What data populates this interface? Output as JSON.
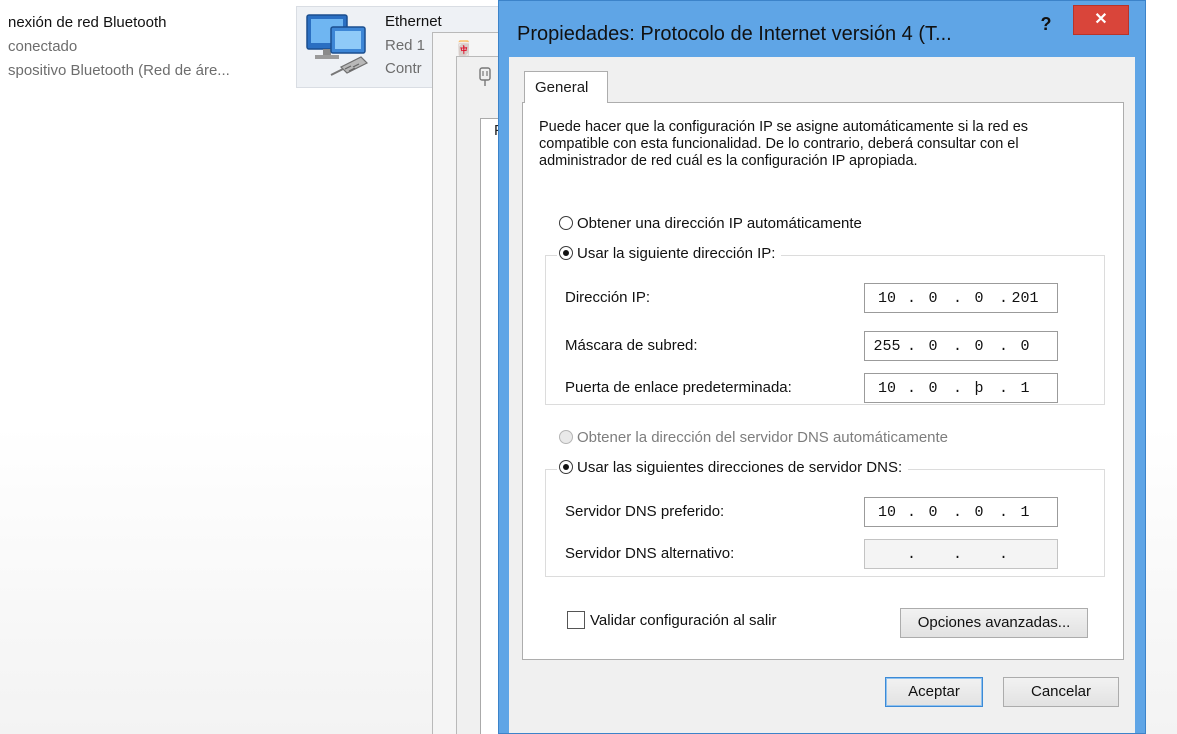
{
  "connections": {
    "bluetooth": {
      "title": "nexión de red Bluetooth",
      "status": "conectado",
      "device": "spositivo Bluetooth (Red de áre..."
    },
    "ethernet": {
      "title": "Ethernet",
      "network": "Red 1",
      "controller": "Contr"
    }
  },
  "background": {
    "partial_tab_label": "F"
  },
  "dialog": {
    "title": "Propiedades: Protocolo de Internet versión 4 (T...",
    "help_label": "?",
    "close_label": "✕",
    "tab_general": "General",
    "description": "Puede hacer que la configuración IP se asigne automáticamente si la red es compatible con esta funcionalidad. De lo contrario, deberá consultar con el administrador de red cuál es la configuración IP apropiada.",
    "ip_auto_label": "Obtener una dirección IP automáticamente",
    "ip_manual_label": "Usar la siguiente dirección IP:",
    "ip_manual_selected": true,
    "ip_fields": {
      "ip_address": {
        "label": "Dirección IP:",
        "octets": [
          "10",
          "0",
          "0",
          "201"
        ]
      },
      "subnet_mask": {
        "label": "Máscara de subred:",
        "octets": [
          "255",
          "0",
          "0",
          "0"
        ]
      },
      "gateway": {
        "label": "Puerta de enlace predeterminada:",
        "octets": [
          "10",
          "0",
          "þ",
          "1"
        ]
      }
    },
    "dns_auto_label": "Obtener la dirección del servidor DNS automáticamente",
    "dns_manual_label": "Usar las siguientes direcciones de servidor DNS:",
    "dns_manual_selected": true,
    "dns_fields": {
      "preferred": {
        "label": "Servidor DNS preferido:",
        "octets": [
          "10",
          "0",
          "0",
          "1"
        ]
      },
      "alternate": {
        "label": "Servidor DNS alternativo:",
        "octets": [
          "",
          "",
          "",
          ""
        ]
      }
    },
    "validate_label": "Validar configuración al salir",
    "validate_checked": false,
    "advanced_button": "Opciones avanzadas...",
    "ok_button": "Aceptar",
    "cancel_button": "Cancelar"
  },
  "colors": {
    "dialog_frame": "#5fa5e6",
    "close_button": "#d9453a",
    "client_bg": "#f0f0f0"
  }
}
